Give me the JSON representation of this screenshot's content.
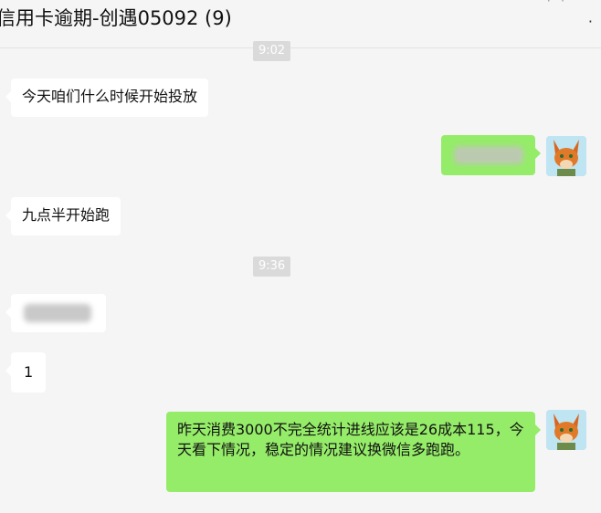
{
  "header": {
    "title": "信用卡逾期-创遇05092 (9)",
    "more_icon": "more-dots-icon"
  },
  "timestamps": {
    "t1": "9:02",
    "t2": "9:36"
  },
  "messages": [
    {
      "side": "in",
      "text": "今天咱们什么时候开始投放"
    },
    {
      "side": "out",
      "text": ""
    },
    {
      "side": "in",
      "text": "九点半开始跑"
    },
    {
      "side": "in",
      "text": ""
    },
    {
      "side": "in",
      "text": "1"
    },
    {
      "side": "out",
      "text": "昨天消费3000不完全统计进线应该是26成本115，今天看下情况，稳定的情况建议换微信多跑跑。"
    }
  ],
  "colors": {
    "outgoing_bubble": "#95ec69",
    "incoming_bubble": "#ffffff",
    "background": "#f5f5f5"
  }
}
